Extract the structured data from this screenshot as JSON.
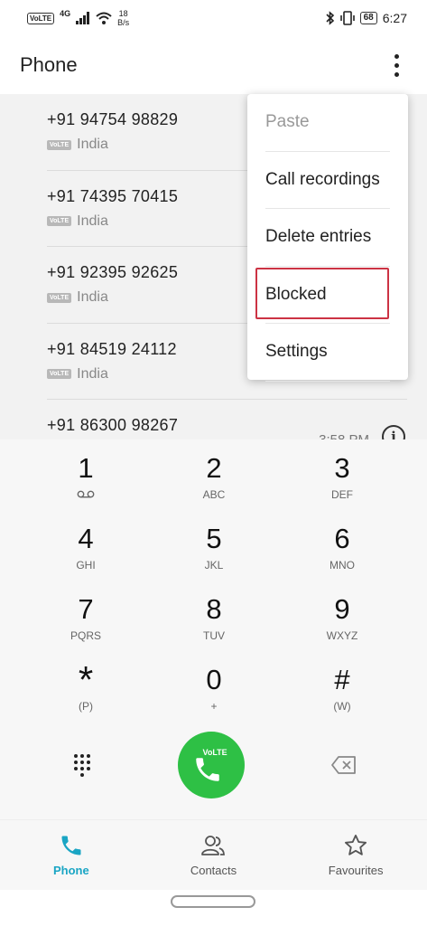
{
  "status_bar": {
    "volte": "VoLTE",
    "network": "4G",
    "speed_value": "18",
    "speed_unit": "B/s",
    "battery": "68",
    "time": "6:27"
  },
  "header": {
    "title": "Phone",
    "more_icon": "more-vertical-icon"
  },
  "call_log": [
    {
      "number": "+91 94754 98829",
      "badge": "VoLTE",
      "location": "India"
    },
    {
      "number": "+91 74395 70415",
      "badge": "VoLTE",
      "location": "India"
    },
    {
      "number": "+91 92395 92625",
      "badge": "VoLTE",
      "location": "India"
    },
    {
      "number": "+91 84519 24112",
      "badge": "VoLTE",
      "location": "India"
    },
    {
      "number": "+91 86300 98267",
      "time": "3:58 PM"
    }
  ],
  "menu": {
    "items": [
      "Paste",
      "Call recordings",
      "Delete entries",
      "Blocked",
      "Settings"
    ],
    "highlighted": "Blocked",
    "highlight_color": "#cc3344"
  },
  "dialpad": {
    "keys": [
      {
        "digit": "1",
        "letters": ""
      },
      {
        "digit": "2",
        "letters": "ABC"
      },
      {
        "digit": "3",
        "letters": "DEF"
      },
      {
        "digit": "4",
        "letters": "GHI"
      },
      {
        "digit": "5",
        "letters": "JKL"
      },
      {
        "digit": "6",
        "letters": "MNO"
      },
      {
        "digit": "7",
        "letters": "PQRS"
      },
      {
        "digit": "8",
        "letters": "TUV"
      },
      {
        "digit": "9",
        "letters": "WXYZ"
      },
      {
        "digit": "*",
        "letters": "(P)"
      },
      {
        "digit": "0",
        "letters": "+"
      },
      {
        "digit": "#",
        "letters": "(W)"
      }
    ],
    "call_label": "VoLTE",
    "call_color": "#2ec045"
  },
  "bottom_nav": {
    "items": [
      {
        "label": "Phone",
        "icon": "phone-icon",
        "active": true
      },
      {
        "label": "Contacts",
        "icon": "contacts-icon",
        "active": false
      },
      {
        "label": "Favourites",
        "icon": "star-icon",
        "active": false
      }
    ],
    "active_color": "#1aa5c4"
  }
}
